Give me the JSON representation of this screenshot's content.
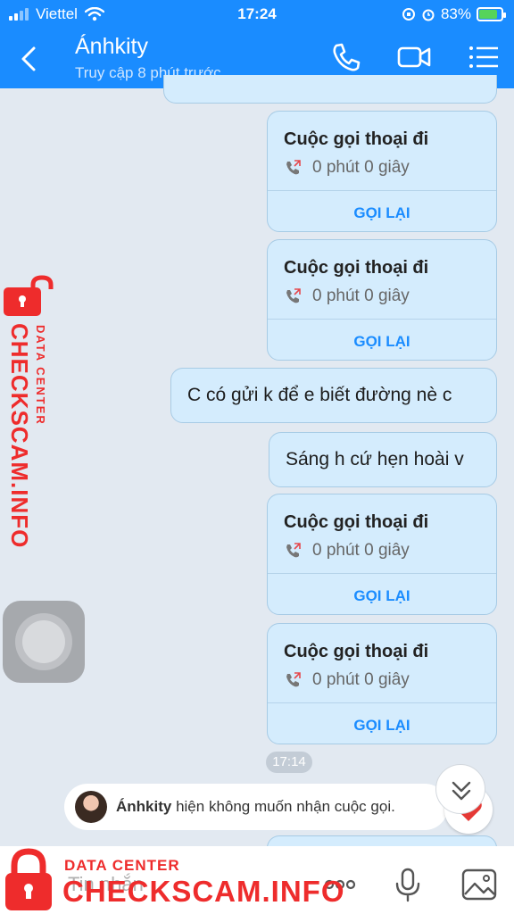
{
  "status": {
    "carrier": "Viettel",
    "time": "17:24",
    "battery": "83%",
    "battery_level": 0.83
  },
  "header": {
    "contact_name": "Ánhkity",
    "contact_status": "Truy cập 8 phút trước"
  },
  "calls": [
    {
      "title": "Cuộc gọi thoại đi",
      "duration": "0 phút 0 giây",
      "action": "GỌI LẠI"
    },
    {
      "title": "Cuộc gọi thoại đi",
      "duration": "0 phút 0 giây",
      "action": "GỌI LẠI"
    },
    {
      "title": "Cuộc gọi thoại đi",
      "duration": "0 phút 0 giây",
      "action": "GỌI LẠI"
    },
    {
      "title": "Cuộc gọi thoại đi",
      "duration": "0 phút 0 giây",
      "action": "GỌI LẠI"
    }
  ],
  "messages": [
    {
      "text": "C có gửi k để e biết đường nè c"
    },
    {
      "text": "Sáng h cứ hẹn hoài v"
    }
  ],
  "timestamp": "17:14",
  "notice": {
    "name": "Ánhkity",
    "text": "hiện không muốn nhận cuộc gọi."
  },
  "composer": {
    "placeholder": "Tin nhắn"
  },
  "watermark": {
    "line1": "DATA CENTER",
    "line2": "CHECKSCAM.INFO"
  },
  "colors": {
    "header": "#1a8cff",
    "bubble": "#d4ecfd",
    "watermark": "#ee2c2c",
    "chat_bg": "#e2e9f1"
  },
  "icons": [
    "back-icon",
    "phone-icon",
    "video-call-icon",
    "menu-list-icon",
    "outgoing-call-icon",
    "scroll-down-icon",
    "heart-icon",
    "more-icon",
    "microphone-icon",
    "image-icon",
    "lock-icon"
  ]
}
